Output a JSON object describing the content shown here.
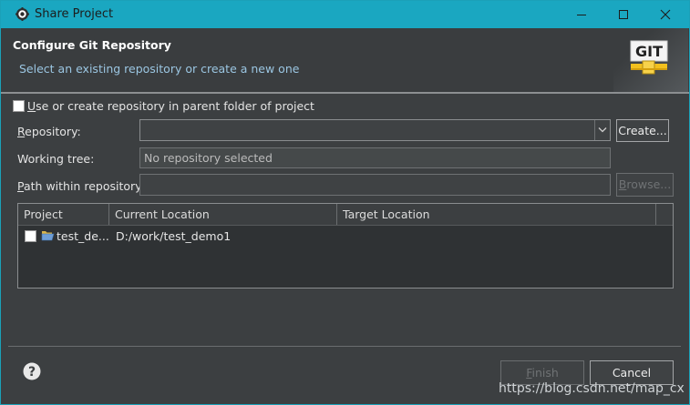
{
  "window": {
    "title": "Share Project",
    "icon": "eclipse-gear-icon"
  },
  "header": {
    "title": "Configure Git Repository",
    "description": "Select an existing repository or create a new one",
    "logo_text": "GIT",
    "logo_icon": "git-logo-icon"
  },
  "form": {
    "use_parent_checkbox_label": "Use or create repository in parent folder of project",
    "use_parent_checked": false,
    "repository_label": "Repository:",
    "repository_value": "",
    "create_button": "Create...",
    "working_tree_label": "Working tree:",
    "working_tree_value": "No repository selected",
    "path_label": "Path within repository:",
    "path_value": "",
    "browse_button": "Browse..."
  },
  "table": {
    "columns": [
      "Project",
      "Current Location",
      "Target Location"
    ],
    "rows": [
      {
        "project": "test_de...",
        "current_location": "D:/work/test_demo1",
        "target_location": "",
        "checked": false,
        "icon": "folder-open-icon"
      }
    ]
  },
  "footer": {
    "finish_button": "Finish",
    "finish_enabled": false,
    "cancel_button": "Cancel",
    "watermark": "https://blog.csdn.net/map_cx"
  },
  "colors": {
    "titlebar": "#1aa7c1",
    "background": "#3c3f41",
    "header_desc": "#9bc6e2"
  }
}
